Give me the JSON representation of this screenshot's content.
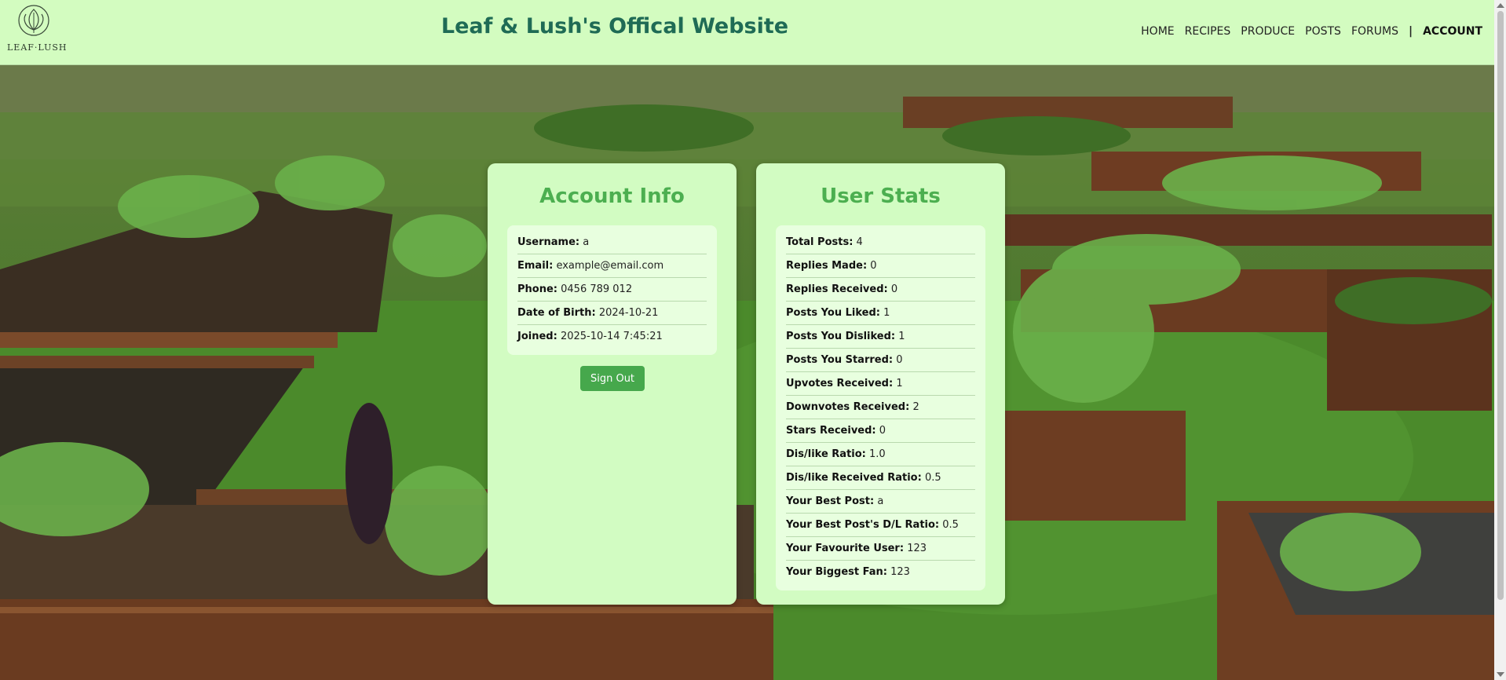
{
  "header": {
    "logo_text": "LEAF·LUSH",
    "site_title": "Leaf & Lush's Offical Website",
    "nav": [
      {
        "label": "HOME"
      },
      {
        "label": "RECIPES"
      },
      {
        "label": "PRODUCE"
      },
      {
        "label": "POSTS"
      },
      {
        "label": "FORUMS"
      }
    ],
    "separator": "|",
    "account_label": "ACCOUNT"
  },
  "account": {
    "title": "Account Info",
    "rows": [
      {
        "label": "Username:",
        "value": "a"
      },
      {
        "label": "Email:",
        "value": "example@email.com"
      },
      {
        "label": "Phone:",
        "value": "0456 789 012"
      },
      {
        "label": "Date of Birth:",
        "value": "2024-10-21"
      },
      {
        "label": "Joined:",
        "value": "2025-10-14 7:45:21"
      }
    ],
    "sign_out_label": "Sign Out"
  },
  "stats": {
    "title": "User Stats",
    "rows": [
      {
        "label": "Total Posts:",
        "value": "4"
      },
      {
        "label": "Replies Made:",
        "value": "0"
      },
      {
        "label": "Replies Received:",
        "value": "0"
      },
      {
        "label": "Posts You Liked:",
        "value": "1"
      },
      {
        "label": "Posts You Disliked:",
        "value": "1"
      },
      {
        "label": "Posts You Starred:",
        "value": "0"
      },
      {
        "label": "Upvotes Received:",
        "value": "1"
      },
      {
        "label": "Downvotes Received:",
        "value": "2"
      },
      {
        "label": "Stars Received:",
        "value": "0"
      },
      {
        "label": "Dis/like Ratio:",
        "value": "1.0"
      },
      {
        "label": "Dis/like Received Ratio:",
        "value": "0.5"
      },
      {
        "label": "Your Best Post:",
        "value": "a"
      },
      {
        "label": "Your Best Post's D/L Ratio:",
        "value": "0.5"
      },
      {
        "label": "Your Favourite User:",
        "value": "123"
      },
      {
        "label": "Your Biggest Fan:",
        "value": "123"
      }
    ]
  },
  "colors": {
    "header_bg": "#d3fcc0",
    "title_color": "#1f6b55",
    "card_bg": "#d2fcc2",
    "card_heading": "#4caf50",
    "button_bg": "#46a84c"
  }
}
